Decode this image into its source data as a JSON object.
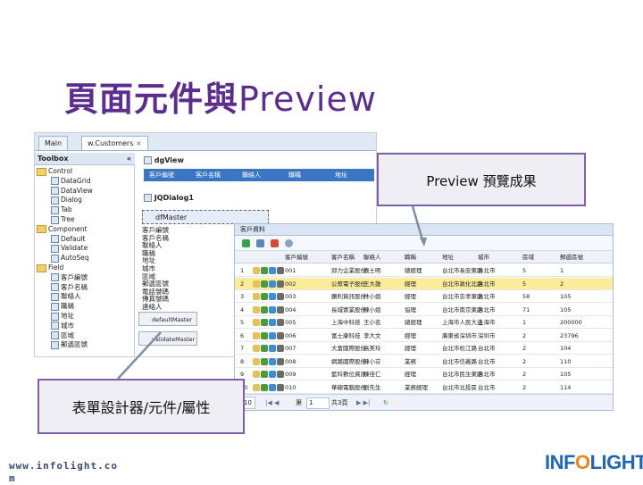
{
  "slide": {
    "title_zh": "頁面元件與",
    "title_en": "Preview",
    "preview_caption": "Preview 預覽成果",
    "designer_caption": "表單設計器/元件/屬性",
    "website": "www.infolight.com",
    "logo_left": "INF",
    "logo_mid": "O",
    "logo_right": "LIGHT"
  },
  "designer": {
    "tabs": [
      "Main",
      "w.Customers"
    ],
    "toolbox_title": "Toolbox",
    "toolbox_items": [
      {
        "label": "Control",
        "kind": "folder"
      },
      {
        "label": "DataGrid",
        "kind": "item"
      },
      {
        "label": "DataView",
        "kind": "item"
      },
      {
        "label": "Dialog",
        "kind": "item"
      },
      {
        "label": "Tab",
        "kind": "item"
      },
      {
        "label": "Tree",
        "kind": "item"
      },
      {
        "label": "Component",
        "kind": "folder"
      },
      {
        "label": "Default",
        "kind": "item"
      },
      {
        "label": "Validate",
        "kind": "item"
      },
      {
        "label": "AutoSeq",
        "kind": "item"
      },
      {
        "label": "Field",
        "kind": "folder"
      },
      {
        "label": "客戶編號",
        "kind": "item"
      },
      {
        "label": "客戶名稱",
        "kind": "item"
      },
      {
        "label": "聯絡人",
        "kind": "item"
      },
      {
        "label": "職稱",
        "kind": "item"
      },
      {
        "label": "地址",
        "kind": "item"
      },
      {
        "label": "城市",
        "kind": "item"
      },
      {
        "label": "區域",
        "kind": "item"
      },
      {
        "label": "郵遞區號",
        "kind": "item"
      }
    ],
    "dgview_title": "dgView",
    "dgview_columns": [
      "客戶編號",
      "客戶名稱",
      "聯絡人",
      "職稱",
      "地址"
    ],
    "dialog_title": "JQDialog1",
    "master_title": "dfMaster",
    "master_fields": [
      "客戶編號",
      "客戶名稱",
      "聯絡人",
      "職稱",
      "地址",
      "城市",
      "區域",
      "郵遞區號",
      "電話號碼",
      "傳真號碼",
      "連絡人"
    ],
    "components": [
      "defaultMaster",
      "validateMaster"
    ]
  },
  "grid": {
    "title": "客戶資料",
    "columns": [
      "客戶編號",
      "客戶名稱",
      "聯絡人",
      "職稱",
      "地址",
      "城市",
      "區域",
      "郵遞區號"
    ],
    "rows": [
      {
        "n": "1",
        "id": "001",
        "name": "邱力企業股份",
        "contact": "嘉士明",
        "title": "總經理",
        "addr": "台北市長安東路",
        "city": "台北市",
        "area": "5",
        "zip": "1",
        "selected": false
      },
      {
        "n": "2",
        "id": "002",
        "name": "公眾電子股份",
        "contact": "王大雄",
        "title": "經理",
        "addr": "台北市敦化北路",
        "city": "台北市",
        "area": "5",
        "zip": "2",
        "selected": true
      },
      {
        "n": "3",
        "id": "003",
        "name": "鵬利資訊股份",
        "contact": "林小姐",
        "title": "經理",
        "addr": "台北市忠孝東路",
        "city": "台北市",
        "area": "58",
        "zip": "105",
        "selected": false
      },
      {
        "n": "4",
        "id": "004",
        "name": "長城實業股份",
        "contact": "陳小姐",
        "title": "協理",
        "addr": "台北市南京東路",
        "city": "台北市",
        "area": "71",
        "zip": "105",
        "selected": false
      },
      {
        "n": "5",
        "id": "005",
        "name": "上海中科技",
        "contact": "王小名",
        "title": "總經理",
        "addr": "上海市人民大道",
        "city": "上海市",
        "area": "1",
        "zip": "200000",
        "selected": false
      },
      {
        "n": "6",
        "id": "006",
        "name": "富士康科技",
        "contact": "李大文",
        "title": "經理",
        "addr": "廣東省深圳市",
        "city": "深圳市",
        "area": "2",
        "zip": "23796",
        "selected": false
      },
      {
        "n": "7",
        "id": "007",
        "name": "大富國際股份",
        "contact": "高美玲",
        "title": "經理",
        "addr": "台北市松江路",
        "city": "台北市",
        "area": "2",
        "zip": "104",
        "selected": false
      },
      {
        "n": "8",
        "id": "008",
        "name": "網路國際股份",
        "contact": "陳小芬",
        "title": "業務",
        "addr": "台北市信義路",
        "city": "台北市",
        "area": "2",
        "zip": "110",
        "selected": false
      },
      {
        "n": "9",
        "id": "009",
        "name": "藍科數位資訊",
        "contact": "陳佳仁",
        "title": "經理",
        "addr": "台北市民生東路",
        "city": "台北市",
        "area": "2",
        "zip": "105",
        "selected": false
      },
      {
        "n": "10",
        "id": "010",
        "name": "華碩電腦股份",
        "contact": "劉先生",
        "title": "業務經理",
        "addr": "台北市北投區",
        "city": "台北市",
        "area": "2",
        "zip": "114",
        "selected": false
      }
    ],
    "pager_size": "10",
    "pager_page": "1",
    "pager_total": "共3頁"
  },
  "colors": {
    "title": "#5b2d8e",
    "caption_border": "#7f5fa6",
    "grid_header": "#3a76c4",
    "selected_row": "#fbec9b",
    "logo_blue": "#1f66b3",
    "logo_orange": "#e8891e"
  }
}
